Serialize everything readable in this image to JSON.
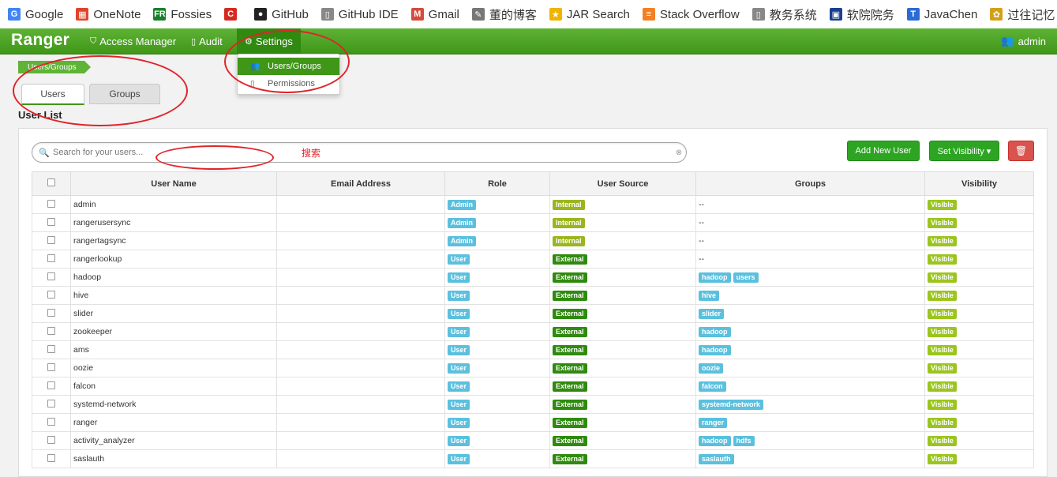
{
  "bookmarks": [
    {
      "label": "Google",
      "icon": "google-icon",
      "icon_char": "G",
      "color": "#4285f4"
    },
    {
      "label": "OneNote",
      "icon": "onenote-icon",
      "icon_char": "▦",
      "color": "#e0442b"
    },
    {
      "label": "Fossies",
      "icon": "fossies-icon",
      "icon_char": "FR",
      "color": "#1a7f2a"
    },
    {
      "label": "",
      "icon": "red-c-icon",
      "icon_char": "C",
      "color": "#d62a1f"
    },
    {
      "label": "GitHub",
      "icon": "github-icon",
      "icon_char": "●",
      "color": "#222222"
    },
    {
      "label": "GitHub IDE",
      "icon": "page-icon",
      "icon_char": "▯",
      "color": "#888888"
    },
    {
      "label": "Gmail",
      "icon": "gmail-icon",
      "icon_char": "M",
      "color": "#d54b3d"
    },
    {
      "label": "董的博客",
      "icon": "feather-icon",
      "icon_char": "✎",
      "color": "#777777"
    },
    {
      "label": "JAR Search",
      "icon": "jar-icon",
      "icon_char": "★",
      "color": "#f0b400"
    },
    {
      "label": "Stack Overflow",
      "icon": "stackoverflow-icon",
      "icon_char": "≡",
      "color": "#f48024"
    },
    {
      "label": "教务系统",
      "icon": "page-icon",
      "icon_char": "▯",
      "color": "#888888"
    },
    {
      "label": "软院院务",
      "icon": "building-icon",
      "icon_char": "▣",
      "color": "#1a3f8f"
    },
    {
      "label": "JavaChen",
      "icon": "t-icon",
      "icon_char": "T",
      "color": "#2a6bd6"
    },
    {
      "label": "过往记忆",
      "icon": "memory-icon",
      "icon_char": "✿",
      "color": "#d4a019"
    }
  ],
  "navbar": {
    "brand": "Ranger",
    "access_manager": "Access Manager",
    "audit": "Audit",
    "settings": "Settings",
    "user": "admin"
  },
  "dropdown": {
    "users_groups": "Users/Groups",
    "permissions": "Permissions"
  },
  "breadcrumb": "Users/Groups",
  "tabs": {
    "users": "Users",
    "groups": "Groups"
  },
  "section_title": "User List",
  "search": {
    "placeholder": "Search for your users...",
    "value": ""
  },
  "annotation_text": "搜索",
  "buttons": {
    "add_user": "Add New User",
    "set_visibility": "Set Visibility ▾",
    "delete": "🗑"
  },
  "table": {
    "columns": [
      "User Name",
      "Email Address",
      "Role",
      "User Source",
      "Groups",
      "Visibility"
    ],
    "rows": [
      {
        "name": "admin",
        "email": "",
        "role": "Admin",
        "source": "Internal",
        "groups": [],
        "visibility": "Visible"
      },
      {
        "name": "rangerusersync",
        "email": "",
        "role": "Admin",
        "source": "Internal",
        "groups": [],
        "visibility": "Visible"
      },
      {
        "name": "rangertagsync",
        "email": "",
        "role": "Admin",
        "source": "Internal",
        "groups": [],
        "visibility": "Visible"
      },
      {
        "name": "rangerlookup",
        "email": "",
        "role": "User",
        "source": "External",
        "groups": [],
        "visibility": "Visible"
      },
      {
        "name": "hadoop",
        "email": "",
        "role": "User",
        "source": "External",
        "groups": [
          "hadoop",
          "users"
        ],
        "visibility": "Visible"
      },
      {
        "name": "hive",
        "email": "",
        "role": "User",
        "source": "External",
        "groups": [
          "hive"
        ],
        "visibility": "Visible"
      },
      {
        "name": "slider",
        "email": "",
        "role": "User",
        "source": "External",
        "groups": [
          "slider"
        ],
        "visibility": "Visible"
      },
      {
        "name": "zookeeper",
        "email": "",
        "role": "User",
        "source": "External",
        "groups": [
          "hadoop"
        ],
        "visibility": "Visible"
      },
      {
        "name": "ams",
        "email": "",
        "role": "User",
        "source": "External",
        "groups": [
          "hadoop"
        ],
        "visibility": "Visible"
      },
      {
        "name": "oozie",
        "email": "",
        "role": "User",
        "source": "External",
        "groups": [
          "oozie"
        ],
        "visibility": "Visible"
      },
      {
        "name": "falcon",
        "email": "",
        "role": "User",
        "source": "External",
        "groups": [
          "falcon"
        ],
        "visibility": "Visible"
      },
      {
        "name": "systemd-network",
        "email": "",
        "role": "User",
        "source": "External",
        "groups": [
          "systemd-network"
        ],
        "visibility": "Visible"
      },
      {
        "name": "ranger",
        "email": "",
        "role": "User",
        "source": "External",
        "groups": [
          "ranger"
        ],
        "visibility": "Visible"
      },
      {
        "name": "activity_analyzer",
        "email": "",
        "role": "User",
        "source": "External",
        "groups": [
          "hadoop",
          "hdfs"
        ],
        "visibility": "Visible"
      },
      {
        "name": "saslauth",
        "email": "",
        "role": "User",
        "source": "External",
        "groups": [
          "saslauth"
        ],
        "visibility": "Visible"
      }
    ],
    "empty_groups": "--"
  }
}
